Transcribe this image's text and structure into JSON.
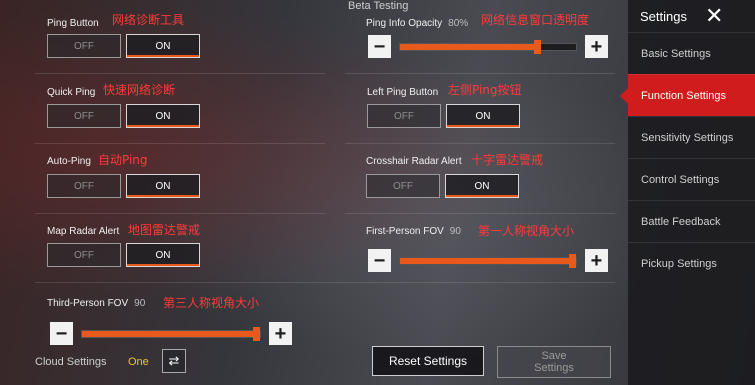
{
  "header": {
    "beta_label": "Beta Testing"
  },
  "settings": {
    "ping_button": {
      "label": "Ping Button",
      "annotation": "网络诊断工具",
      "off": "OFF",
      "on": "ON"
    },
    "quick_ping": {
      "label": "Quick Ping",
      "annotation": "快速网络诊断",
      "off": "OFF",
      "on": "ON"
    },
    "auto_ping": {
      "label": "Auto-Ping",
      "annotation": "自动Ping",
      "off": "OFF",
      "on": "ON"
    },
    "map_radar_alert": {
      "label": "Map Radar Alert",
      "annotation": "地图雷达警戒",
      "off": "OFF",
      "on": "ON"
    },
    "ping_info_opacity": {
      "label": "Ping Info Opacity",
      "value": "80%",
      "annotation": "网络信息窗口透明度",
      "level": 0.8
    },
    "left_ping_button": {
      "label": "Left Ping Button",
      "annotation": "左侧Ping按钮",
      "off": "OFF",
      "on": "ON"
    },
    "crosshair_radar_alert": {
      "label": "Crosshair Radar Alert",
      "annotation": "十字雷达警戒",
      "off": "OFF",
      "on": "ON"
    },
    "first_person_fov": {
      "label": "First-Person FOV",
      "value": "90",
      "annotation": "第一人称视角大小",
      "level": 1.0
    },
    "third_person_fov": {
      "label": "Third-Person FOV",
      "value": "90",
      "annotation": "第三人称视角大小",
      "level": 1.0
    }
  },
  "slider_icons": {
    "minus": "−",
    "plus": "+"
  },
  "sidebar": {
    "title": "Settings",
    "close_icon": "✕",
    "items": [
      {
        "label": "Basic Settings"
      },
      {
        "label": "Function Settings",
        "active": true
      },
      {
        "label": "Sensitivity Settings"
      },
      {
        "label": "Control Settings"
      },
      {
        "label": "Battle Feedback"
      },
      {
        "label": "Pickup Settings"
      }
    ]
  },
  "footer": {
    "cloud_label": "Cloud Settings",
    "cloud_value": "One",
    "sync_icon": "⇄",
    "reset_label": "Reset Settings",
    "save_label": "Save Settings"
  },
  "colors": {
    "accent": "#e85a1c",
    "active_tab": "#d01c1c",
    "annotation": "#ff3a3a",
    "cloud_value": "#f0c040"
  }
}
